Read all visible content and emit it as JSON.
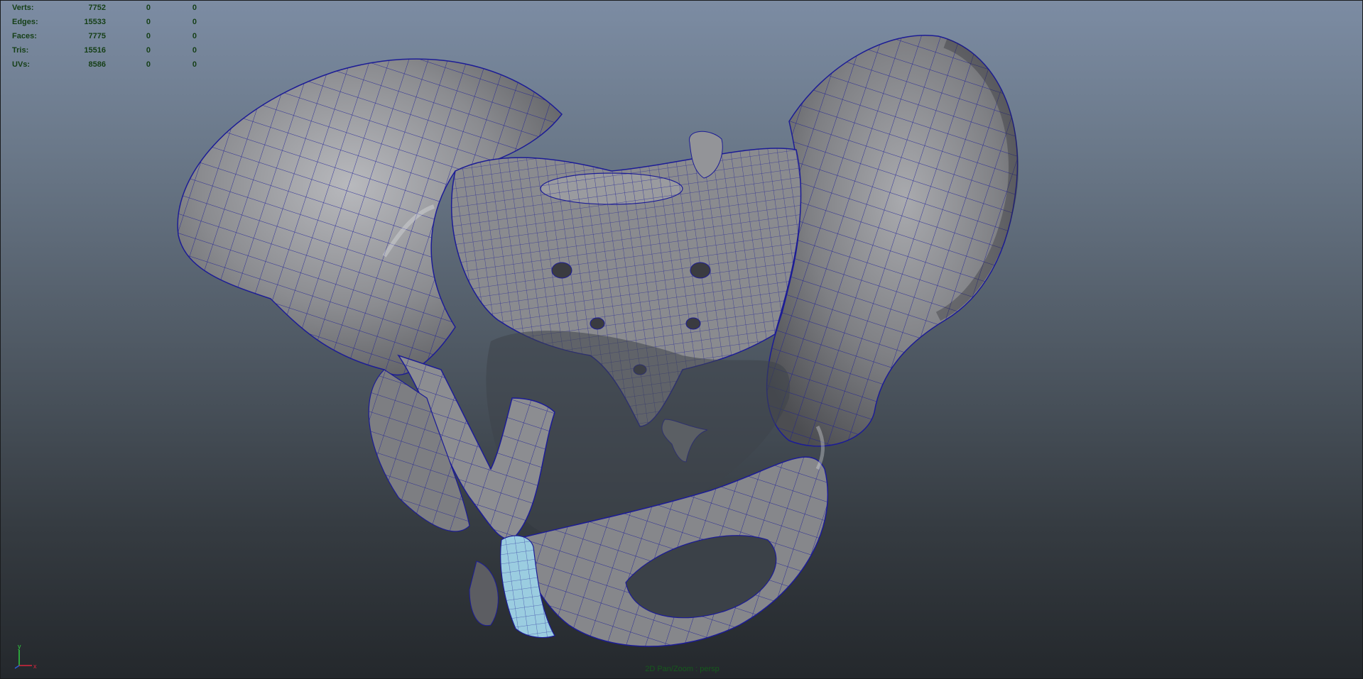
{
  "hud": {
    "rows": [
      {
        "label": "Verts:",
        "value": "7752",
        "sel1": "0",
        "sel2": "0"
      },
      {
        "label": "Edges:",
        "value": "15533",
        "sel1": "0",
        "sel2": "0"
      },
      {
        "label": "Faces:",
        "value": "7775",
        "sel1": "0",
        "sel2": "0"
      },
      {
        "label": "Tris:",
        "value": "15516",
        "sel1": "0",
        "sel2": "0"
      },
      {
        "label": "UVs:",
        "value": "8586",
        "sel1": "0",
        "sel2": "0"
      }
    ]
  },
  "axis": {
    "y_label": "y",
    "x_label": "x"
  },
  "camera_label": "2D Pan/Zoom : persp",
  "colors": {
    "wireframe": "#1c1c96",
    "mesh_fill": "#8d8e92",
    "selection_highlight": "#9bcde0",
    "hud_text": "#153f16"
  }
}
